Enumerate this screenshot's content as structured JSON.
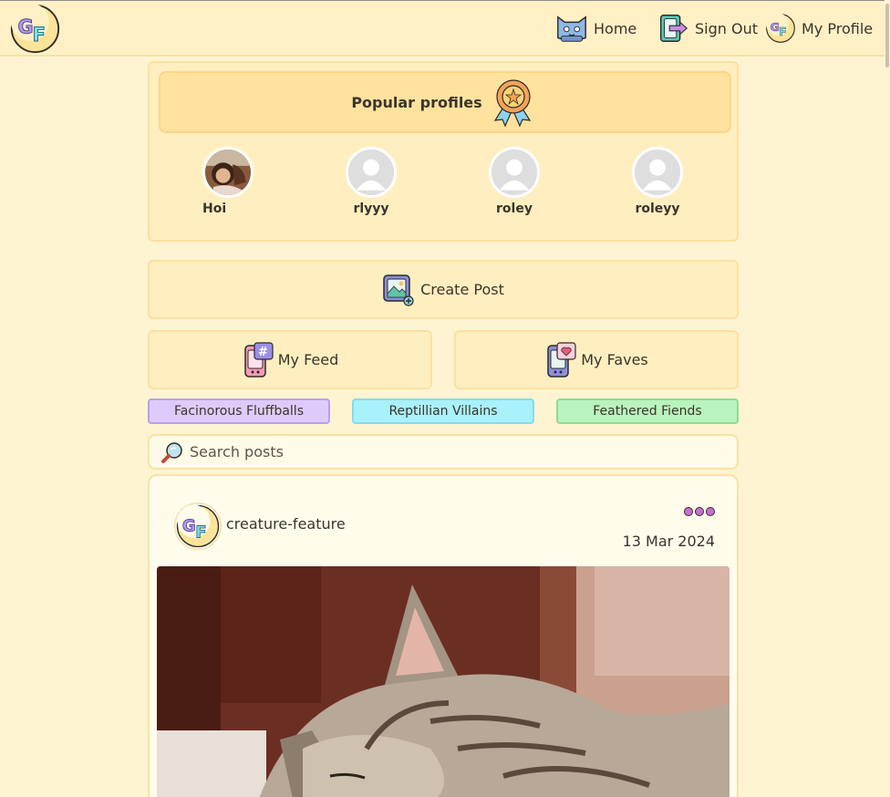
{
  "nav": {
    "home_label": "Home",
    "signout_label": "Sign Out",
    "profile_label": "My Profile"
  },
  "popular": {
    "title": "Popular profiles",
    "profiles": [
      {
        "name": "Hoi",
        "has_photo": true
      },
      {
        "name": "rlyyy",
        "has_photo": false
      },
      {
        "name": "roley",
        "has_photo": false
      },
      {
        "name": "roleyy",
        "has_photo": false
      }
    ]
  },
  "actions": {
    "create_post": "Create Post",
    "my_feed": "My Feed",
    "my_faves": "My Faves"
  },
  "tags": [
    {
      "label": "Facinorous Fluffballs",
      "bg": "#dfcbfb",
      "border": "#b79ff0"
    },
    {
      "label": "Reptillian Villains",
      "bg": "#a9f1fb",
      "border": "#7ddff0"
    },
    {
      "label": "Feathered Fiends",
      "bg": "#b9f3bd",
      "border": "#8edc94"
    }
  ],
  "search": {
    "placeholder": "Search posts"
  },
  "post": {
    "username": "creature-feature",
    "date": "13 Mar 2024"
  },
  "colors": {
    "page_bg": "#fff4d2",
    "card_bg": "#ffefc0",
    "accent_menu": "#c86fd3"
  }
}
